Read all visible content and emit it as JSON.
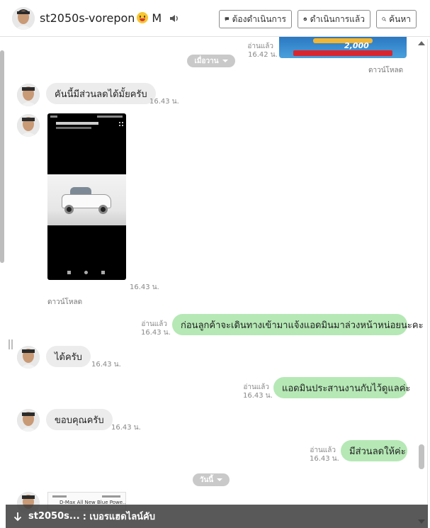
{
  "header": {
    "contact_name": "st2050s-vorepon",
    "contact_tag": "M",
    "buttons": {
      "todo": "ต้องดำเนินการ",
      "done": "ดำเนินการแล้ว",
      "search": "ค้นหา"
    }
  },
  "top_banner": {
    "read_label": "อ่านแล้ว",
    "time": "16.42 น.",
    "number": "2,000",
    "download_label": "ดาวน์โหลด"
  },
  "date_chips": {
    "yesterday": "เมื่อวาน",
    "today": "วันนี้"
  },
  "messages": [
    {
      "direction": "in",
      "text": "คันนี้มีส่วนลดได้มั้ยครับ",
      "time": "16.43 น."
    },
    {
      "direction": "in",
      "type": "image",
      "time": "16.43 น.",
      "download_label": "ดาวน์โหลด",
      "image_title": "โชคดูณโมด ยาเเมส"
    },
    {
      "direction": "out",
      "text": "ก่อนลูกค้าจะเดินทางเข้ามาแจ้งแอดมินมาล่วงหน้าหน่อยนะคะ",
      "time": "16.43 น.",
      "read_label": "อ่านแล้ว"
    },
    {
      "direction": "in",
      "text": "ได้ครับ",
      "time": "16.43 น."
    },
    {
      "direction": "out",
      "text": "แอดมินประสานงานกับไว้ดูแลค่ะ",
      "time": "16.43 น.",
      "read_label": "อ่านแล้ว"
    },
    {
      "direction": "in",
      "text": "ขอบคุณครับ",
      "time": "16.43 น."
    },
    {
      "direction": "out",
      "text": "มีส่วนลดให้ค่ะ",
      "time": "16.43 น.",
      "read_label": "อ่านแล้ว"
    },
    {
      "direction": "in",
      "type": "image",
      "image_title": "D-Max All New Blue Powe..."
    }
  ],
  "notification": {
    "sender": "st2050s...",
    "preview": ": เบอรแฮดไลน์คับ"
  },
  "colors": {
    "outgoing_bubble": "#b5e8b5",
    "incoming_bubble": "#ececec",
    "date_chip": "#c9c9c9"
  }
}
